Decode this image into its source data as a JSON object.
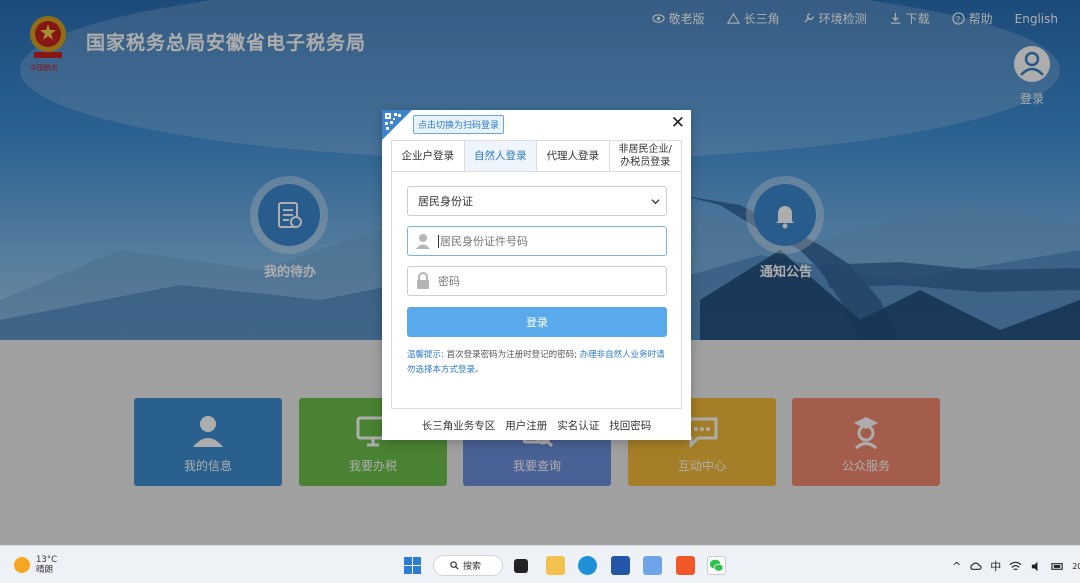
{
  "header": {
    "site_title": "国家税务总局安徽省电子税务局",
    "nav": [
      {
        "label": "敬老版",
        "icon": "eye-icon"
      },
      {
        "label": "长三角",
        "icon": "triangle-icon"
      },
      {
        "label": "环境检测",
        "icon": "wrench-icon"
      },
      {
        "label": "下载",
        "icon": "download-icon"
      },
      {
        "label": "帮助",
        "icon": "help-icon"
      },
      {
        "label": "English",
        "icon": ""
      }
    ],
    "login_label": "登录"
  },
  "hero": {
    "left_feature": "我的待办",
    "right_feature": "通知公告"
  },
  "tiles": [
    {
      "label": "我的信息",
      "color": "#3e8ed0"
    },
    {
      "label": "我要办税",
      "color": "#6cc04a"
    },
    {
      "label": "我要查询",
      "color": "#6e8fdc"
    },
    {
      "label": "互动中心",
      "color": "#f3bb3a"
    },
    {
      "label": "公众服务",
      "color": "#f18a6e"
    }
  ],
  "modal": {
    "qr_tip": "点击切换为扫码登录",
    "close": "✕",
    "tabs": [
      "企业户登录",
      "自然人登录",
      "代理人登录",
      "非居民企业/办税员登录"
    ],
    "active_tab": 1,
    "id_type": "居民身份证",
    "id_placeholder": "居民身份证件号码",
    "password_placeholder": "密码",
    "login_button": "登录",
    "tip_title": "温馨提示:",
    "tip_text": "首次登录密码为注册时登记的密码;",
    "tip_link": "办理非自然人业务时请勿选择本方式登录。",
    "links": [
      "长三角业务专区",
      "用户注册",
      "实名认证",
      "找回密码"
    ]
  },
  "taskbar": {
    "temperature": "13°C",
    "weather": "晴朗",
    "search_label": "搜索",
    "ime": "中",
    "clock_partial": "20"
  },
  "colors": {
    "accent": "#2b79c9",
    "button": "#5aa9ec"
  }
}
